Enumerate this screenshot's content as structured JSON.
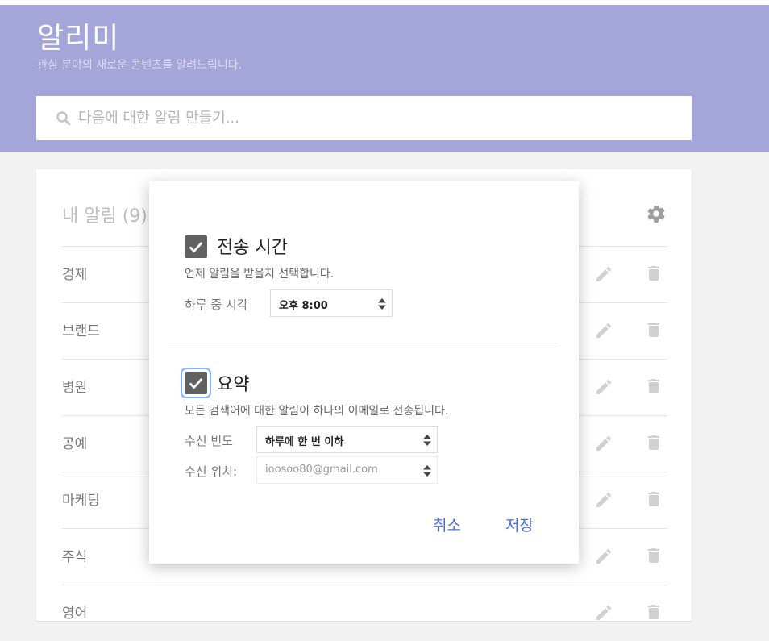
{
  "header": {
    "title": "알리미",
    "subtitle": "관심 분야의 새로운 콘텐츠를 알려드립니다."
  },
  "search": {
    "placeholder": "다음에 대한 알림 만들기..."
  },
  "alerts_card": {
    "title": "내 알림 (9)",
    "items": [
      {
        "label": "경제"
      },
      {
        "label": "브랜드"
      },
      {
        "label": "병원"
      },
      {
        "label": "공예"
      },
      {
        "label": "마케팅"
      },
      {
        "label": "주식"
      },
      {
        "label": "영어"
      }
    ]
  },
  "dialog": {
    "delivery_time": {
      "checked": true,
      "title": "전송 시간",
      "description": "언제 알림을 받을지 선택합니다.",
      "time_label": "하루 중 시각",
      "time_value": "오후 8:00"
    },
    "digest": {
      "checked": true,
      "title": "요약",
      "description": "모든 검색어에 대한 알림이 하나의 이메일로 전송됩니다.",
      "frequency_label": "수신 빈도",
      "frequency_value": "하루에 한 번 이하",
      "destination_label": "수신 위치:",
      "destination_value": "ioosoo80@gmail.com"
    },
    "cancel_label": "취소",
    "save_label": "저장"
  },
  "colors": {
    "header_bg": "#a4a6d9",
    "accent_blue": "#4a6fd4",
    "checkbox_bg": "#616161"
  },
  "icons": {
    "search": "search-icon",
    "settings": "gear-icon",
    "edit": "pencil-icon",
    "delete": "trash-icon",
    "checkbox": "checkmark-icon",
    "select": "updown-arrows-icon"
  }
}
